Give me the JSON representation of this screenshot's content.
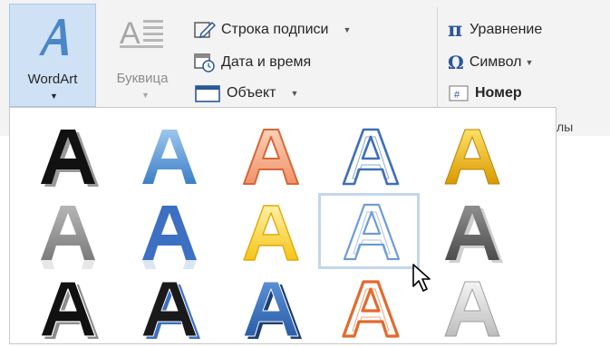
{
  "ribbon": {
    "wordart_label": "WordArt",
    "bukvica_label": "Буквица",
    "signature_line_label": "Строка подписи",
    "date_time_label": "Дата и время",
    "object_label": "Объект",
    "equation_label": "Уравнение",
    "symbol_label": "Символ",
    "number_label": "Номер",
    "group_label_partial": "лы"
  },
  "gallery": {
    "glyph": "A",
    "styles": [
      [
        "black-shadow",
        "blue-gradient",
        "orange-outline",
        "blue-outline",
        "gold-gradient"
      ],
      [
        "gray-reflection",
        "blue-reflection",
        "yellow-gradient",
        "light-blue-outline",
        "dark-gray-3d"
      ],
      [
        "black-bold-shadow",
        "black-blue-shadow",
        "blue-bold",
        "orange-outline-bold",
        "silver-gradient"
      ]
    ],
    "selected": [
      1,
      3
    ]
  },
  "colors": {
    "accent": "#2b579a",
    "wordart_blue": "#4a86c8",
    "selection": "#c5d6ea",
    "ribbon_bg": "#f3f3f3"
  }
}
